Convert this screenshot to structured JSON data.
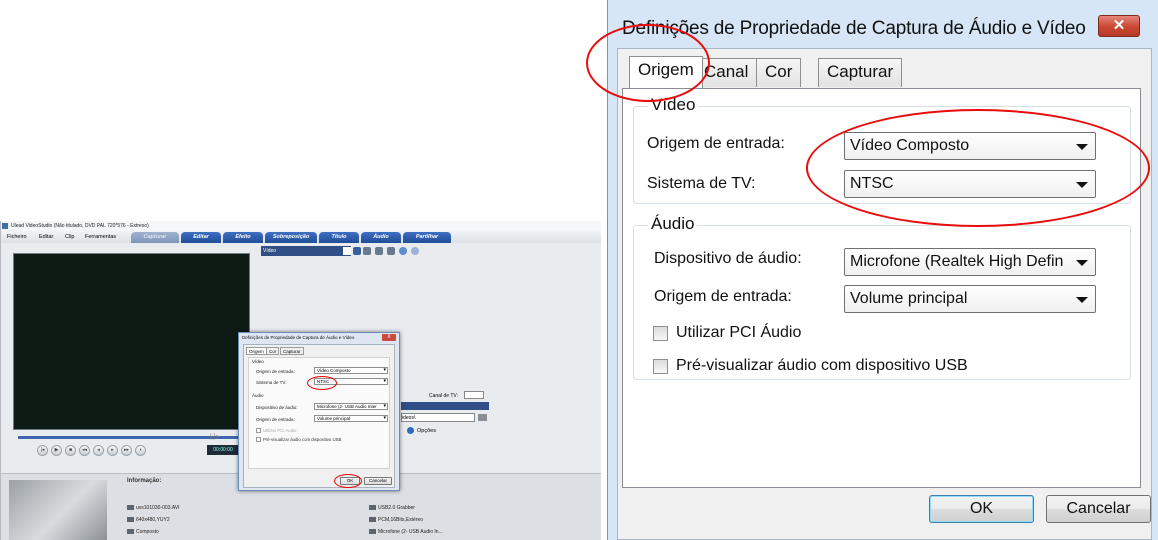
{
  "left_app": {
    "window_title": "Ulead VideoStudio (Não titulado, DVD PAL 720*576 - Extreso)",
    "menu": [
      "Ficheiro",
      "Editar",
      "Clip",
      "Ferramentas"
    ],
    "tabs": [
      "Capturar",
      "Editar",
      "Efeito",
      "Sobreposição",
      "Título",
      "Áudio",
      "Partilhar"
    ],
    "toolbar_dropdown": "Vídeo",
    "timecode": "00:00:00",
    "canal_tv_label": "Canal de TV:",
    "path_value": "ideos\\",
    "opcoes_label": "Opções",
    "info_title": "Informação:",
    "info_left": [
      "uvs101030-003.AVI",
      "640x480,YUY2",
      "Composto"
    ],
    "info_right": [
      "USB2.0 Grabber",
      "PCM,16Bits,Estéreo",
      "Microfone (2- USB Audio In..."
    ]
  },
  "small_dialog": {
    "title": "Definições de Propriedade de Captura de Áudio e Vídeo",
    "close": "X",
    "tabs": [
      "Origem",
      "Cor",
      "Capturar"
    ],
    "video_group": "Vídeo",
    "origem_entrada_label": "Origem de entrada:",
    "origem_entrada_value": "Vídeo Composto",
    "sistema_tv_label": "Sistema de TV:",
    "sistema_tv_value": "NTSC",
    "audio_group": "Áudio",
    "dispositivo_label": "Dispositivo de áudio:",
    "dispositivo_value": "Microfone (2- USB Audio Inter",
    "origem_audio_label": "Origem de entrada:",
    "origem_audio_value": "Volume principal",
    "chk_pci": "Utilizar PCI Audio",
    "chk_usb": "Pré-visualizar áudio com dispositivo USB",
    "ok": "OK",
    "cancel": "Cancelar"
  },
  "dialog": {
    "title": "Definições de Propriedade de Captura de Áudio e Vídeo",
    "close_glyph": "✕",
    "tabs": [
      "Origem",
      "Canal",
      "Cor",
      "Capturar"
    ],
    "active_tab": "Origem",
    "video": {
      "caption": "Vídeo",
      "origem_label": "Origem de entrada:",
      "origem_value": "Vídeo Composto",
      "sistema_label": "Sistema de TV:",
      "sistema_value": "NTSC"
    },
    "audio": {
      "caption": "Áudio",
      "dispositivo_label": "Dispositivo de áudio:",
      "dispositivo_value": "Microfone (Realtek High Defin",
      "origem_label": "Origem de entrada:",
      "origem_value": "Volume principal",
      "chk_pci": "Utilizar PCI Áudio",
      "chk_usb": "Pré-visualizar áudio com dispositivo USB"
    },
    "ok": "OK",
    "cancel": "Cancelar"
  },
  "colors": {
    "annotation_red": "#e80c0c",
    "dialog_frame": "#d6e6f6",
    "app_tab_blue": "#2f5ca8"
  }
}
